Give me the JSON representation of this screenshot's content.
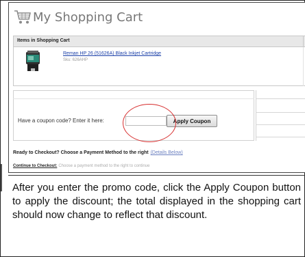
{
  "header": {
    "title": "My Shopping Cart",
    "icon": "shopping-cart-icon"
  },
  "items_table": {
    "heading": "Items in Shopping Cart",
    "items": [
      {
        "name": "Reman HP 26 (51626A) Black Inkjet Cartridge",
        "sku": "Sku: 626AHP",
        "image": "ink-cartridge"
      }
    ]
  },
  "coupon": {
    "label": "Have a coupon code? Enter it here:",
    "input_value": "",
    "button_label": "Apply Coupon",
    "highlight_color": "#d62b2b"
  },
  "checkout": {
    "ready_text": "Ready to Checkout? Choose a Payment Method to the right",
    "details_link": "(Details Below)",
    "continue_label": "Continue to Checkout:",
    "continue_text": "Choose a payment method to the right to continue"
  },
  "caption": "After you enter the promo code, click the Apply Coupon button to apply the discount; the total displayed in the shopping cart should now change to reflect that discount."
}
